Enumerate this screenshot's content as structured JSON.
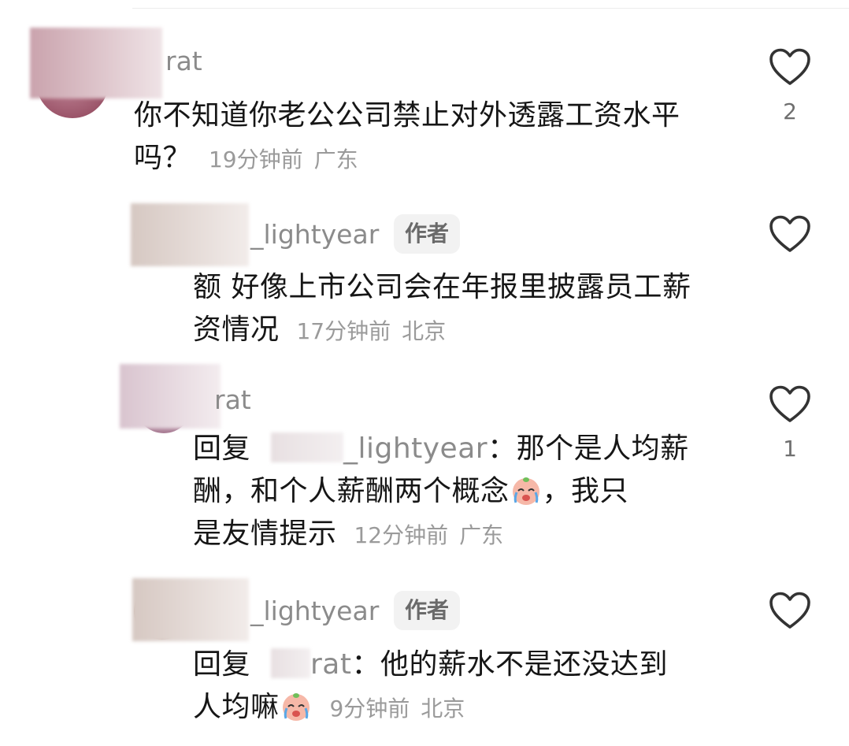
{
  "comments": [
    {
      "username": "rat",
      "text": "你不知道你老公公司禁止对外透露工资水平吗？",
      "time": "19分钟前",
      "location": "广东",
      "likes": "2"
    },
    {
      "username": "_lightyear",
      "badge": "作者",
      "text": "额 好像上市公司会在年报里披露员工薪资情况",
      "time": "17分钟前",
      "location": "北京",
      "likes": ""
    },
    {
      "username": "rat",
      "reply_prefix": "回复",
      "reply_to": "_lightyear",
      "text_line1_suffix": "：那个是人均薪",
      "text_line2": "酬，和个人薪酬两个概念",
      "text_line2_after": "，我只",
      "text_line3": "是友情提示",
      "time": "12分钟前",
      "location": "广东",
      "likes": "1"
    },
    {
      "username": "_lightyear",
      "badge": "作者",
      "reply_prefix": "回复",
      "reply_to": "rat",
      "text_line1_suffix": "：他的薪水不是还没达到",
      "text_line2": "人均嘛",
      "time": "9分钟前",
      "location": "北京",
      "likes": ""
    }
  ],
  "icons": {
    "like": "heart-outline-icon",
    "emoji": "crying-emoji-icon"
  }
}
